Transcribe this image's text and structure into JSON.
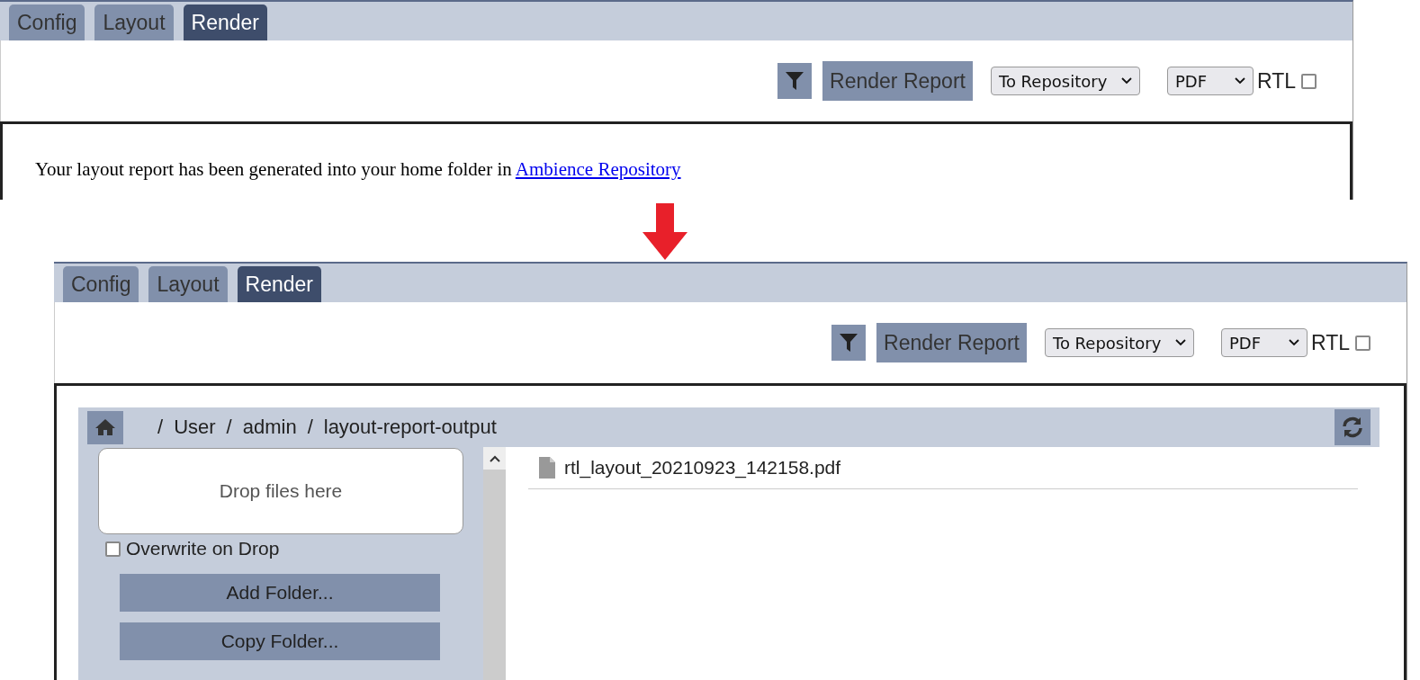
{
  "panels": [
    {
      "kind": "message",
      "tabs": [
        {
          "label": "Config",
          "selected": false
        },
        {
          "label": "Layout",
          "selected": false
        },
        {
          "label": "Render",
          "selected": true
        }
      ],
      "toolbar": {
        "button": "Render Report",
        "destination": "To Repository",
        "format": "PDF",
        "rtl": {
          "label": "RTL",
          "checked": false
        }
      },
      "message": {
        "text": "Your layout report has been generated into your home folder in",
        "link": "Ambience Repository"
      }
    },
    {
      "kind": "file_browser",
      "tabs": [
        {
          "label": "Config",
          "selected": false
        },
        {
          "label": "Layout",
          "selected": false
        },
        {
          "label": "Render",
          "selected": true
        }
      ],
      "toolbar": {
        "button": "Render Report",
        "destination": "To Repository",
        "format": "PDF",
        "rtl": {
          "label": "RTL",
          "checked": false
        }
      },
      "browser": {
        "path_separator": "/",
        "path": [
          "User",
          "admin",
          "layout-report-output"
        ],
        "drop_zone": "Drop files here",
        "overwrite": {
          "label": "Overwrite on Drop",
          "checked": false
        },
        "actions": [
          "Add Folder...",
          "Copy Folder..."
        ],
        "files": [
          "rtl_layout_20210923_142158.pdf"
        ]
      }
    }
  ]
}
